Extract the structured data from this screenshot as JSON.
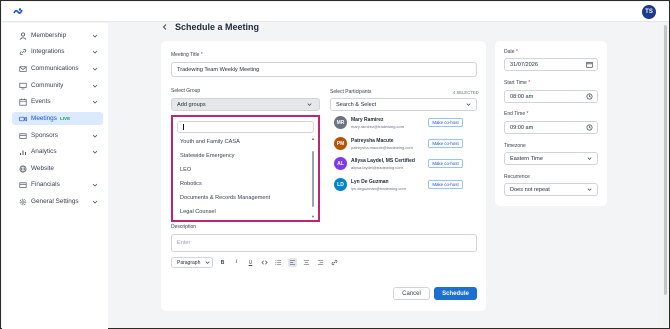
{
  "topbar": {
    "logo_icon": "app-logo-icon",
    "user_initials": "TS"
  },
  "sidebar": {
    "items": [
      {
        "label": "Membership",
        "icon": "users-icon",
        "has_chevron": true
      },
      {
        "label": "Integrations",
        "icon": "link-icon",
        "has_chevron": true
      },
      {
        "label": "Communications",
        "icon": "mail-icon",
        "has_chevron": true
      },
      {
        "label": "Community",
        "icon": "monitor-icon",
        "has_chevron": true
      },
      {
        "label": "Events",
        "icon": "calendar-icon",
        "has_chevron": true
      },
      {
        "label": "Meetings",
        "icon": "video-icon",
        "has_chevron": false,
        "active": true,
        "badge": "LIVE"
      },
      {
        "label": "Sponsors",
        "icon": "card-icon",
        "has_chevron": true
      },
      {
        "label": "Analytics",
        "icon": "bar-chart-icon",
        "has_chevron": true
      },
      {
        "label": "Website",
        "icon": "globe-icon",
        "has_chevron": false
      },
      {
        "label": "Financials",
        "icon": "wallet-icon",
        "has_chevron": true
      },
      {
        "label": "General Settings",
        "icon": "gear-icon",
        "has_chevron": true
      }
    ]
  },
  "page": {
    "title": "Schedule a Meeting"
  },
  "form": {
    "meeting_title_label": "Meeting Title",
    "meeting_title_value": "Tradewing Team Weekly Meeting",
    "select_group_label": "Select Group",
    "select_group_placeholder": "Add groups",
    "group_search_value": "",
    "group_options": [
      "Youth and Family CASA",
      "Statewide Emergency",
      "LEO",
      "Robotics",
      "Documents & Records Management",
      "Legal Counsel"
    ],
    "select_participants_label": "Select Participants",
    "selected_count": "4 SELECTED",
    "participants_placeholder": "Search & Select",
    "participants": [
      {
        "initials": "MR",
        "name": "Mary Ramirez",
        "email": "mary.ramirez@tradewing.com",
        "action": "Make co-host",
        "color": "#6b7280"
      },
      {
        "initials": "PM",
        "name": "Patreysha Macute",
        "email": "patreysha.macute@tradewing.com",
        "action": "Make co-host",
        "color": "#b45309"
      },
      {
        "initials": "AL",
        "name": "Allysa Laydel, MS Certified",
        "email": "allysa.laydel@tradewing.com",
        "action": "Make co-host",
        "color": "#7c3aed"
      },
      {
        "initials": "LD",
        "name": "Lyn De Guzman",
        "email": "lyn.deguzman@tradewing.com",
        "action": "Make co-host",
        "color": "#0284c7"
      }
    ],
    "description_label": "Description",
    "description_placeholder": "Enter",
    "editor_toolbar": {
      "paragraph": "Paragraph",
      "bold": "B",
      "italic": "I",
      "underline": "U"
    },
    "cancel_label": "Cancel",
    "schedule_label": "Schedule"
  },
  "side": {
    "date_label": "Date",
    "date_value": "31/07/2026",
    "start_label": "Start Time",
    "start_value": "08:00 am",
    "end_label": "End Time",
    "end_value": "09:00 am",
    "timezone_label": "Timezone",
    "timezone_value": "Eastern Time",
    "recurrence_label": "Recurrence",
    "recurrence_value": "Does not repeat"
  },
  "colors": {
    "accent": "#1d6fd1",
    "highlight_border": "#c02670",
    "active_nav_bg": "#dbeafe",
    "live_badge": "#16a34a"
  }
}
